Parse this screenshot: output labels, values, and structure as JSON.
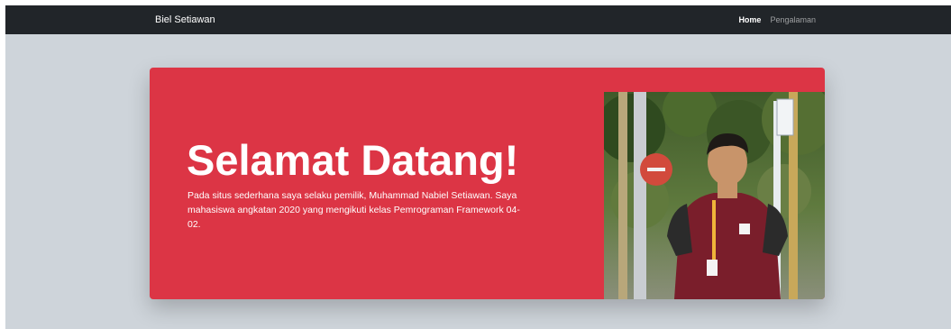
{
  "navbar": {
    "brand": "Biel Setiawan",
    "links": [
      {
        "label": "Home",
        "active": true
      },
      {
        "label": "Pengalaman",
        "active": false
      }
    ]
  },
  "hero": {
    "title": "Selamat Datang!",
    "description": "Pada situs sederhana saya selaku pemilik, Muhammad Nabiel Setiawan. Saya mahasiswa angkatan 2020 yang mengikuti kelas Pemrograman Framework 04-02.",
    "photo": "profile-photo"
  },
  "colors": {
    "navbar": "#212529",
    "page_background": "#ced4da",
    "hero": "#dc3545",
    "text_light": "#ffffff"
  }
}
